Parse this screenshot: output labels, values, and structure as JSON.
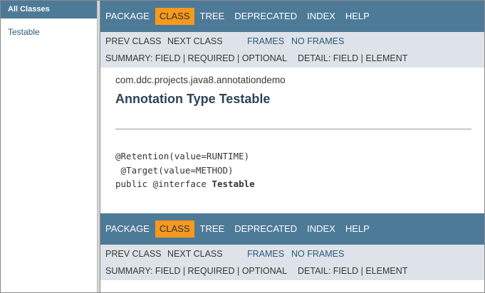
{
  "left": {
    "header": "All Classes",
    "items": [
      "Testable"
    ]
  },
  "nav": {
    "items": [
      "PACKAGE",
      "CLASS",
      "TREE",
      "DEPRECATED",
      "INDEX",
      "HELP"
    ],
    "prev_class": "PREV CLASS",
    "next_class": "NEXT CLASS",
    "frames": "FRAMES",
    "no_frames": "NO FRAMES",
    "summary": "SUMMARY: FIELD | REQUIRED | OPTIONAL",
    "detail": "DETAIL: FIELD | ELEMENT"
  },
  "content": {
    "package": "com.ddc.projects.java8.annotationdemo",
    "title": "Annotation Type Testable",
    "code_line1": "@Retention(value=RUNTIME)",
    "code_line2": " @Target(value=METHOD)",
    "code_line3_prefix": "public @interface ",
    "code_line3_name": "Testable"
  },
  "colors": {
    "nav_bg": "#4d7a97",
    "active_tab": "#f8981d",
    "subnav_bg": "#dee3e9"
  }
}
